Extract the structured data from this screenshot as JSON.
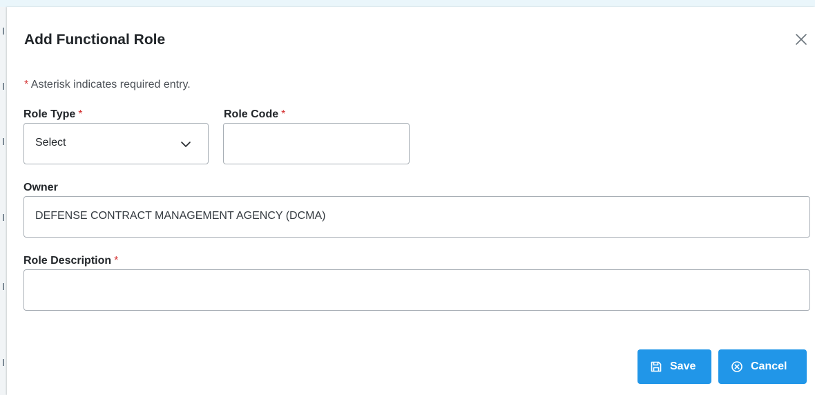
{
  "dialog": {
    "title": "Add Functional Role",
    "required_note_star": "*",
    "required_note": "Asterisk indicates required entry."
  },
  "fields": {
    "role_type": {
      "label": "Role Type",
      "required_mark": "*",
      "value": "Select"
    },
    "role_code": {
      "label": "Role Code",
      "required_mark": "*",
      "value": ""
    },
    "owner": {
      "label": "Owner",
      "value": "DEFENSE CONTRACT MANAGEMENT AGENCY (DCMA)"
    },
    "role_description": {
      "label": "Role Description",
      "required_mark": "*",
      "value": ""
    }
  },
  "actions": {
    "save_label": "Save",
    "cancel_label": "Cancel"
  },
  "icons": {
    "close": "close-icon",
    "chevron": "chevron-down-icon",
    "save": "save-icon",
    "cancel": "cancel-circle-icon"
  },
  "colors": {
    "primary_button": "#2196e8",
    "required_star": "#d32f2f",
    "backdrop": "#eaf6fb"
  }
}
